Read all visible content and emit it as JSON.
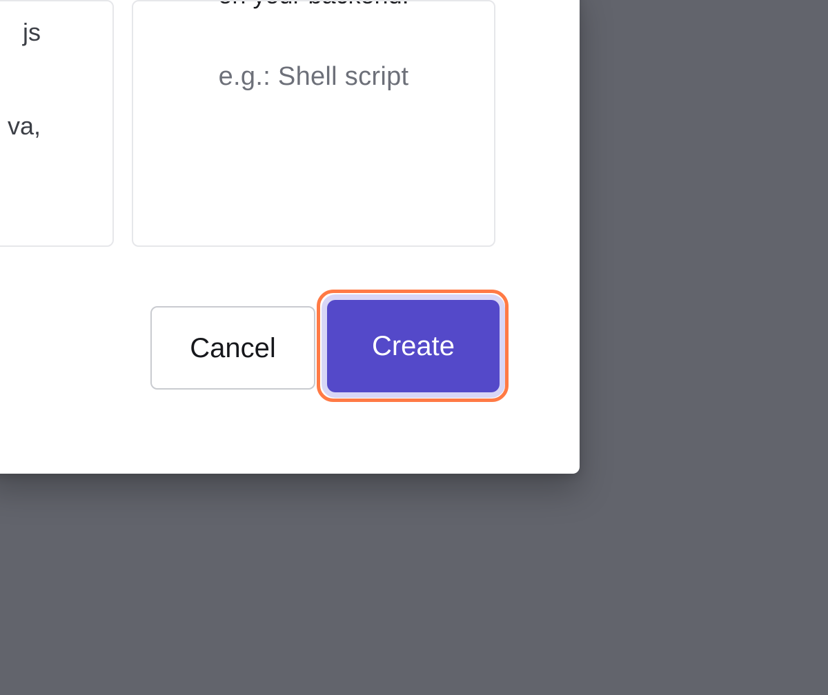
{
  "cards": {
    "left": {
      "line1": "js",
      "line2": "va,"
    },
    "right": {
      "description": "on your backend.",
      "example": "e.g.: Shell script"
    }
  },
  "actions": {
    "cancel_label": "Cancel",
    "create_label": "Create"
  },
  "colors": {
    "backdrop": "#62646c",
    "modal": "#ffffff",
    "primary": "#5449c9",
    "focus_outline": "#ff7a45"
  }
}
